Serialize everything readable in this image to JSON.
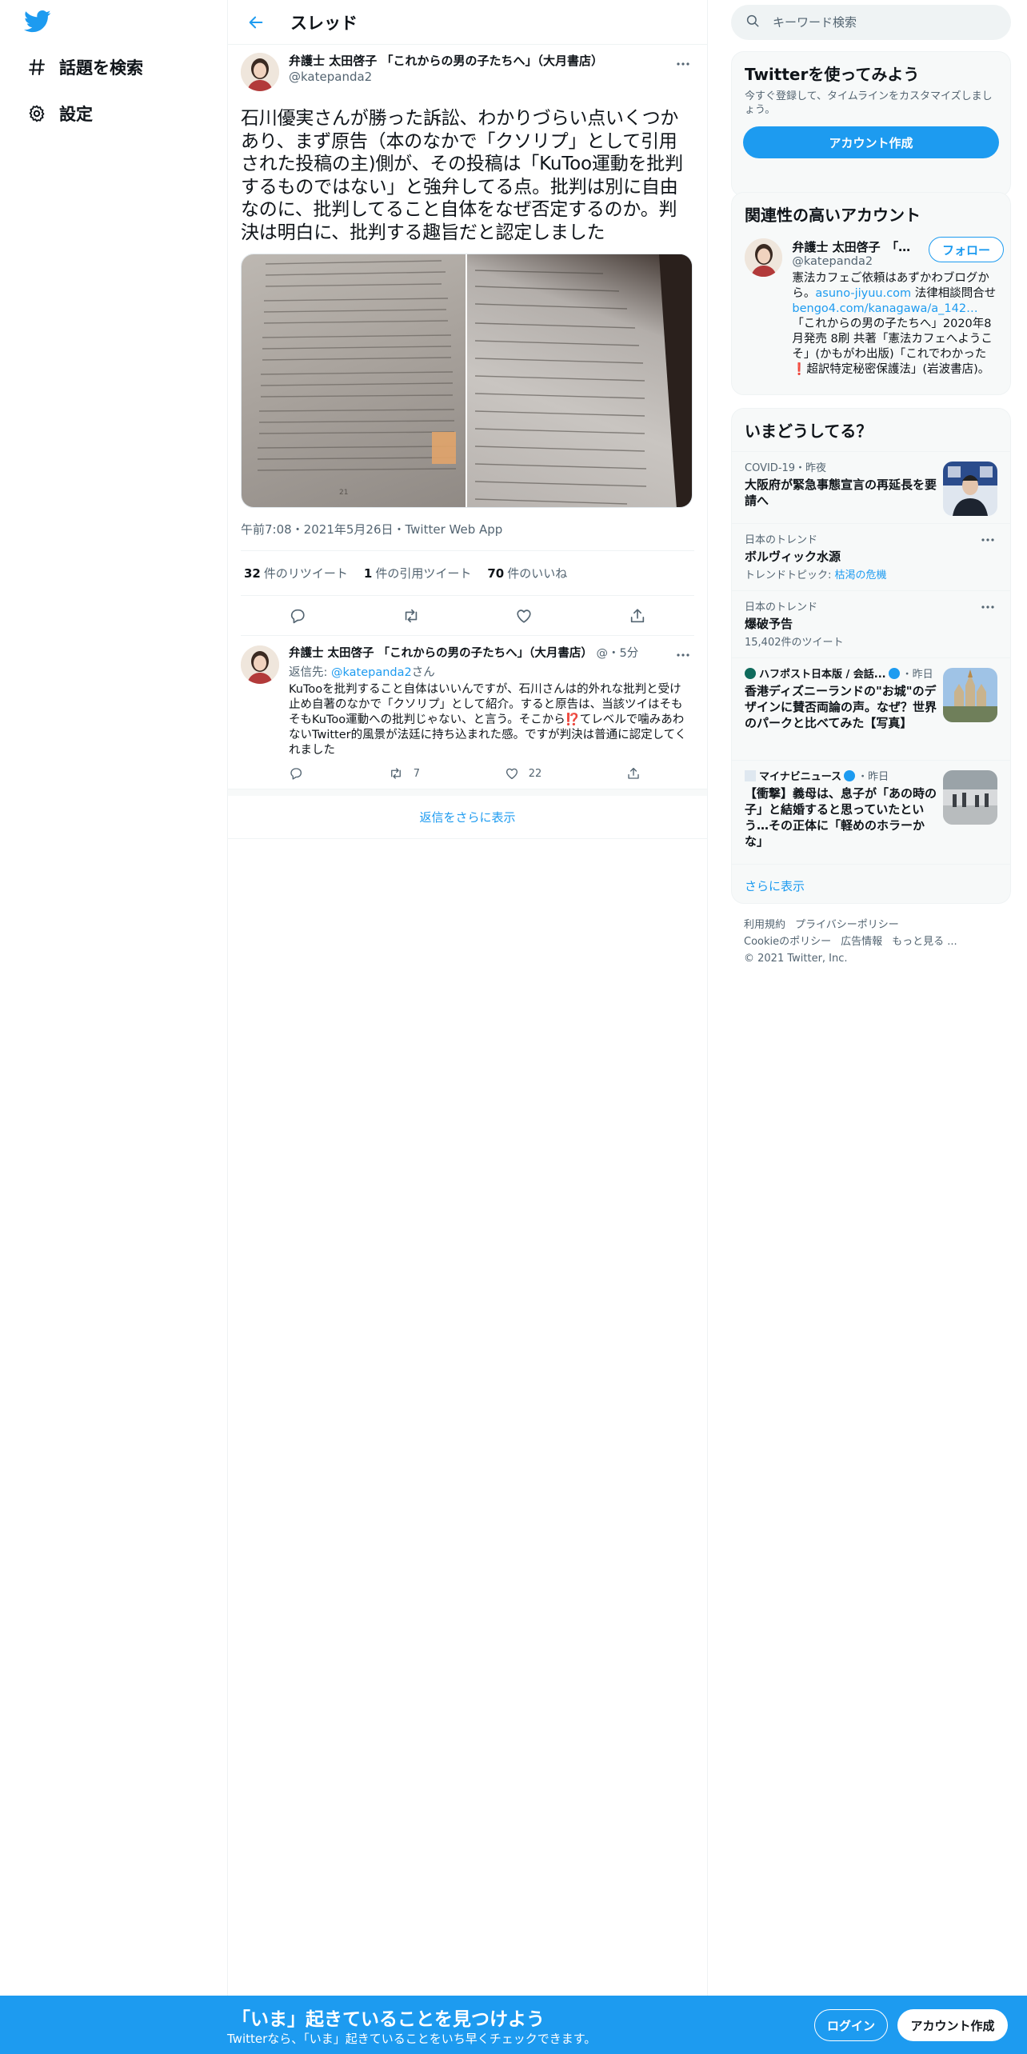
{
  "nav": {
    "items": [
      {
        "label": "話題を検索",
        "icon": "hashtag-icon"
      },
      {
        "label": "設定",
        "icon": "gear-icon"
      }
    ]
  },
  "header": {
    "title": "スレッド"
  },
  "main_tweet": {
    "author_name": "弁護士 太田啓子 「これからの男の子たちへ」（大月書店）",
    "author_handle": "@katepanda2",
    "text": "石川優実さんが勝った訴訟、わかりづらい点いくつかあり、まず原告（本のなかで「クソリプ」として引用された投稿の主)側が、その投稿は「KuToo運動を批判するものではない」と強弁してる点。批判は別に自由なのに、批判してること自体をなぜ否定するのか。判決は明白に、批判する趣旨だと認定しました",
    "timestamp": "午前7:08・2021年5月26日・Twitter Web App",
    "stats": {
      "retweets": "32",
      "retweets_label": "件のリツイート",
      "quotes": "1",
      "quotes_label": "件の引用ツイート",
      "likes": "70",
      "likes_label": "件のいいね"
    }
  },
  "reply": {
    "author_name": "弁護士 太田啓子 「これからの男の子たちへ」（大月書店）",
    "meta": "@・5分",
    "reply_to_prefix": "返信先: ",
    "reply_to_handle": "@katepanda2",
    "reply_to_suffix": "さん",
    "text": "KuTooを批判すること自体はいいんですが、石川さんは的外れな批判と受け止め自著のなかで「クソリプ」として紹介。すると原告は、当該ツイはそもそもKuToo運動への批判じゃない、と言う。そこから⁉️てレベルで噛みあわないTwitter的風景が法廷に持ち込まれた感。ですが判決は普通に認定してくれました",
    "retweets": "7",
    "likes": "22"
  },
  "show_more_replies": "返信をさらに表示",
  "search": {
    "placeholder": "キーワード検索"
  },
  "signup_card": {
    "title": "Twitterを使ってみよう",
    "desc": "今すぐ登録して、タイムラインをカスタマイズしましょう。",
    "button": "アカウント作成"
  },
  "related": {
    "title": "関連性の高いアカウント",
    "name": "弁護士 太田啓子　「これからの男の子たちへ」",
    "handle": "@katepanda2",
    "follow": "フォロー",
    "bio_1": "憲法カフェご依頼はあずかわブログから。",
    "bio_link1": "asuno-jiyuu.com",
    "bio_2": " 法律相談問合せ ",
    "bio_link2": "bengo4.com/kanagawa/a_142…",
    "bio_3": " 「これからの男の子たちへ」2020年8月発売 8刷 共著「憲法カフェへようこそ」(かもがわ出版)「これでわかった❗️超訳特定秘密保護法」(岩波書店)。"
  },
  "trends": {
    "title": "いまどうしてる？",
    "items": [
      {
        "context": "COVID-19・昨夜",
        "title": "大阪府が緊急事態宣言の再延長を要請へ"
      },
      {
        "context": "日本のトレンド",
        "title": "ボルヴィック水源",
        "sub_prefix": "トレンドトピック: ",
        "sub_link": "枯渇の危機"
      },
      {
        "context": "日本のトレンド",
        "title": "爆破予告",
        "sub": "15,402件のツイート"
      },
      {
        "context_name": "ハフポスト日本版 / 会話...",
        "context_time": "・昨日",
        "title": "香港ディズニーランドの\"お城\"のデザインに賛否両論の声。なぜ？世界のパークと比べてみた【写真】"
      },
      {
        "context_name": "マイナビニュース",
        "context_time": "・昨日",
        "title": "【衝撃】義母は、息子が「あの時の子」と結婚すると思っていたという…その正体に「軽めのホラーかな」"
      }
    ],
    "show_more": "さらに表示"
  },
  "footer": {
    "links": [
      "利用規約",
      "プライバシーポリシー",
      "Cookieのポリシー",
      "広告情報",
      "もっと見る ..."
    ],
    "copyright": "© 2021 Twitter, Inc."
  },
  "bottom_bar": {
    "title": "「いま」起きていることを見つけよう",
    "subtitle": "Twitterなら、「いま」起きていることをいち早くチェックできます。",
    "login": "ログイン",
    "signup": "アカウント作成"
  },
  "colors": {
    "accent": "#1d9bf0",
    "text": "#0f1419",
    "secondary": "#536471"
  }
}
